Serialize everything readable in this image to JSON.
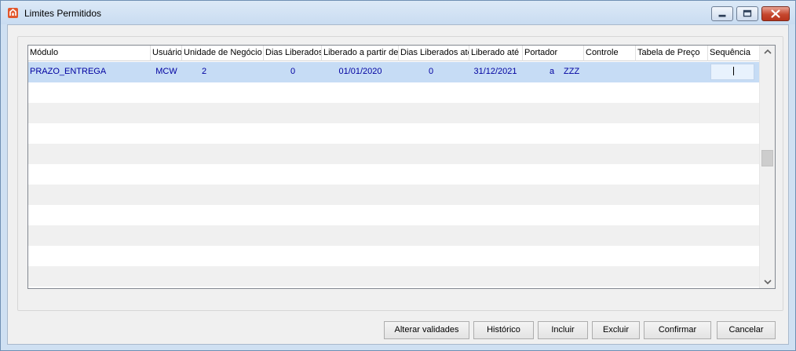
{
  "window": {
    "title": "Limites Permitidos"
  },
  "grid": {
    "columns": [
      {
        "key": "modulo",
        "label": "Módulo"
      },
      {
        "key": "usuario",
        "label": "Usuário"
      },
      {
        "key": "unidade",
        "label": "Unidade de Negócio"
      },
      {
        "key": "dias_liberados",
        "label": "Dias Liberados"
      },
      {
        "key": "liberado_partir",
        "label": "Liberado a partir de"
      },
      {
        "key": "dias_liberados_ate",
        "label": "Dias Liberados até"
      },
      {
        "key": "liberado_ate",
        "label": "Liberado até"
      },
      {
        "key": "portador",
        "label": "Portador"
      },
      {
        "key": "controle",
        "label": "Controle"
      },
      {
        "key": "tabela_preco",
        "label": "Tabela de Preço"
      },
      {
        "key": "sequencia",
        "label": "Sequência"
      }
    ],
    "rows": [
      {
        "modulo": "PRAZO_ENTREGA",
        "usuario": "MCW",
        "unidade": "2",
        "dias_liberados": "0",
        "liberado_partir": "01/01/2020",
        "dias_liberados_ate": "0",
        "liberado_ate": "31/12/2021",
        "portador_code": "a",
        "portador_name": "ZZZ",
        "controle": "",
        "tabela_preco": "",
        "sequencia": ""
      }
    ]
  },
  "buttons": {
    "alterar": "Alterar validades",
    "historico": "Histórico",
    "incluir": "Incluir",
    "excluir": "Excluir",
    "confirmar": "Confirmar",
    "cancelar": "Cancelar"
  },
  "colors": {
    "selected_row": "#c6dcf5",
    "selected_text": "#0000a0",
    "stripe": "#f0f0f0"
  }
}
